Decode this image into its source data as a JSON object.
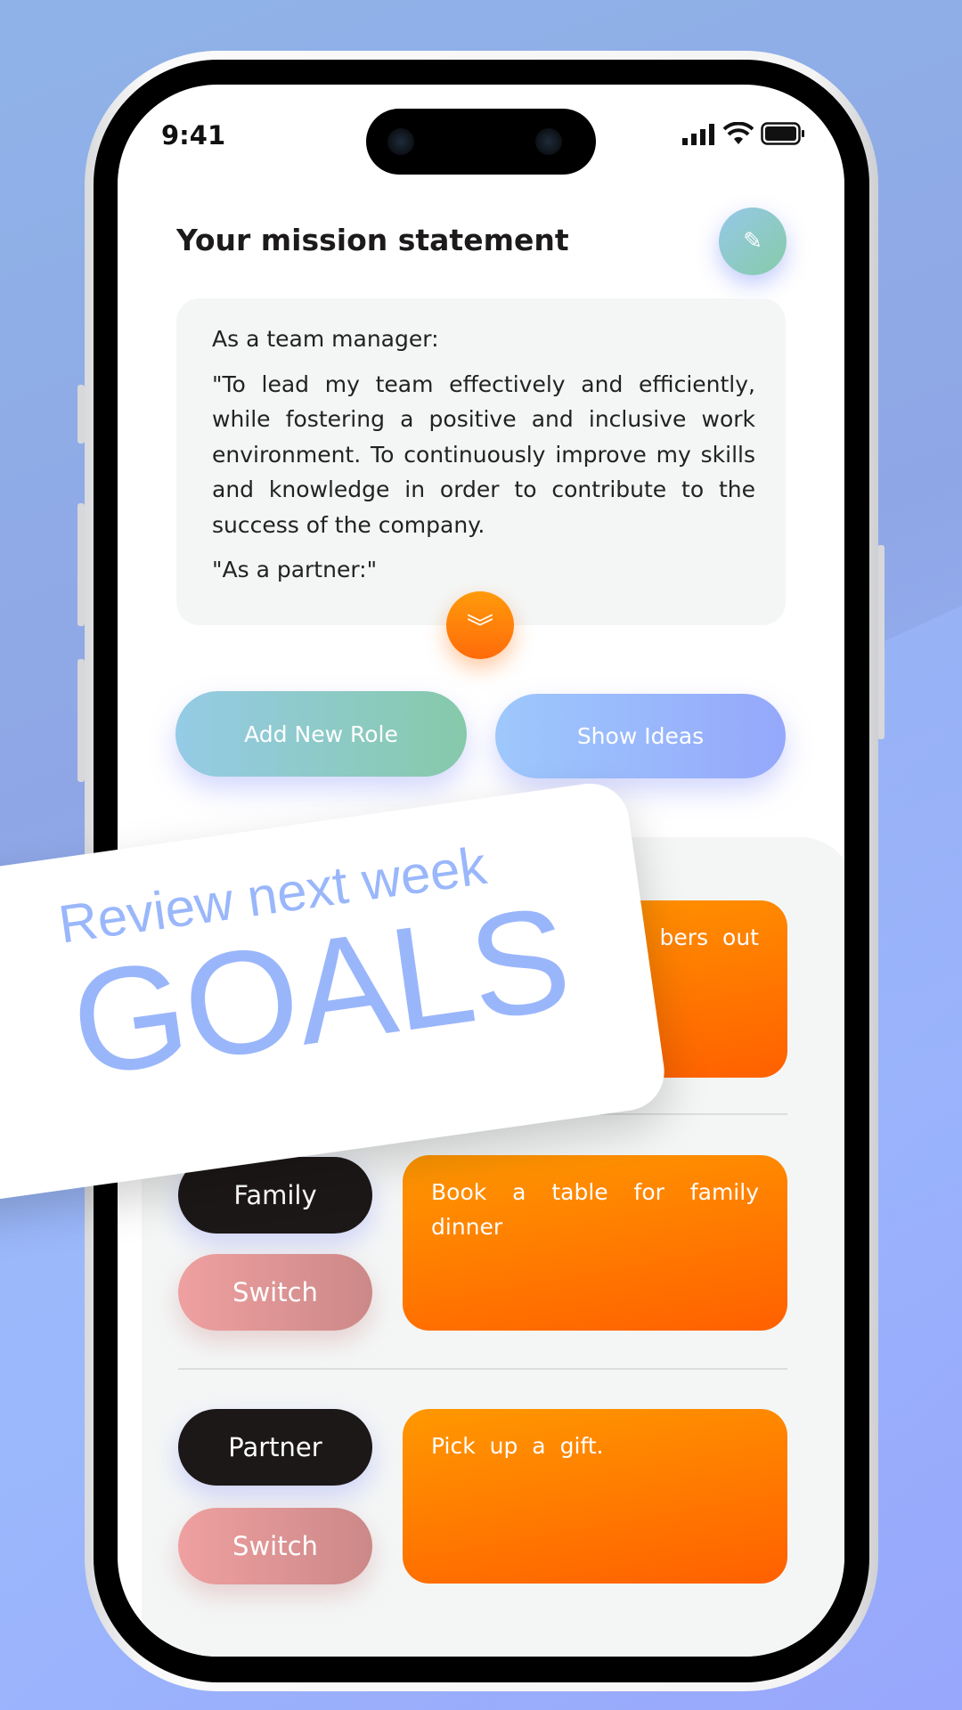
{
  "status_bar": {
    "time": "9:41"
  },
  "mission": {
    "title": "Your mission statement",
    "paragraphs": [
      "As a team manager:",
      "\"To lead my team effectively and efficiently, while fostering a positive and inclusive work environment. To continuously improve my skills and knowledge in order to contribute to the success of the company.",
      "\"As a partner:\""
    ]
  },
  "actions": {
    "add_role": "Add New Role",
    "show_ideas": "Show Ideas"
  },
  "roles": [
    {
      "task": "bers out"
    },
    {
      "name": "Family",
      "switch": "Switch",
      "task": "Book a table for family dinner"
    },
    {
      "name": "Partner",
      "switch": "Switch",
      "task": "Pick up a gift."
    }
  ],
  "overlay": {
    "subtitle": "Review next week",
    "headline": "GOALS"
  },
  "colors": {
    "accent_orange": "#ff7a00",
    "accent_blue": "#9ab7fb",
    "teal": "#86cba8"
  }
}
